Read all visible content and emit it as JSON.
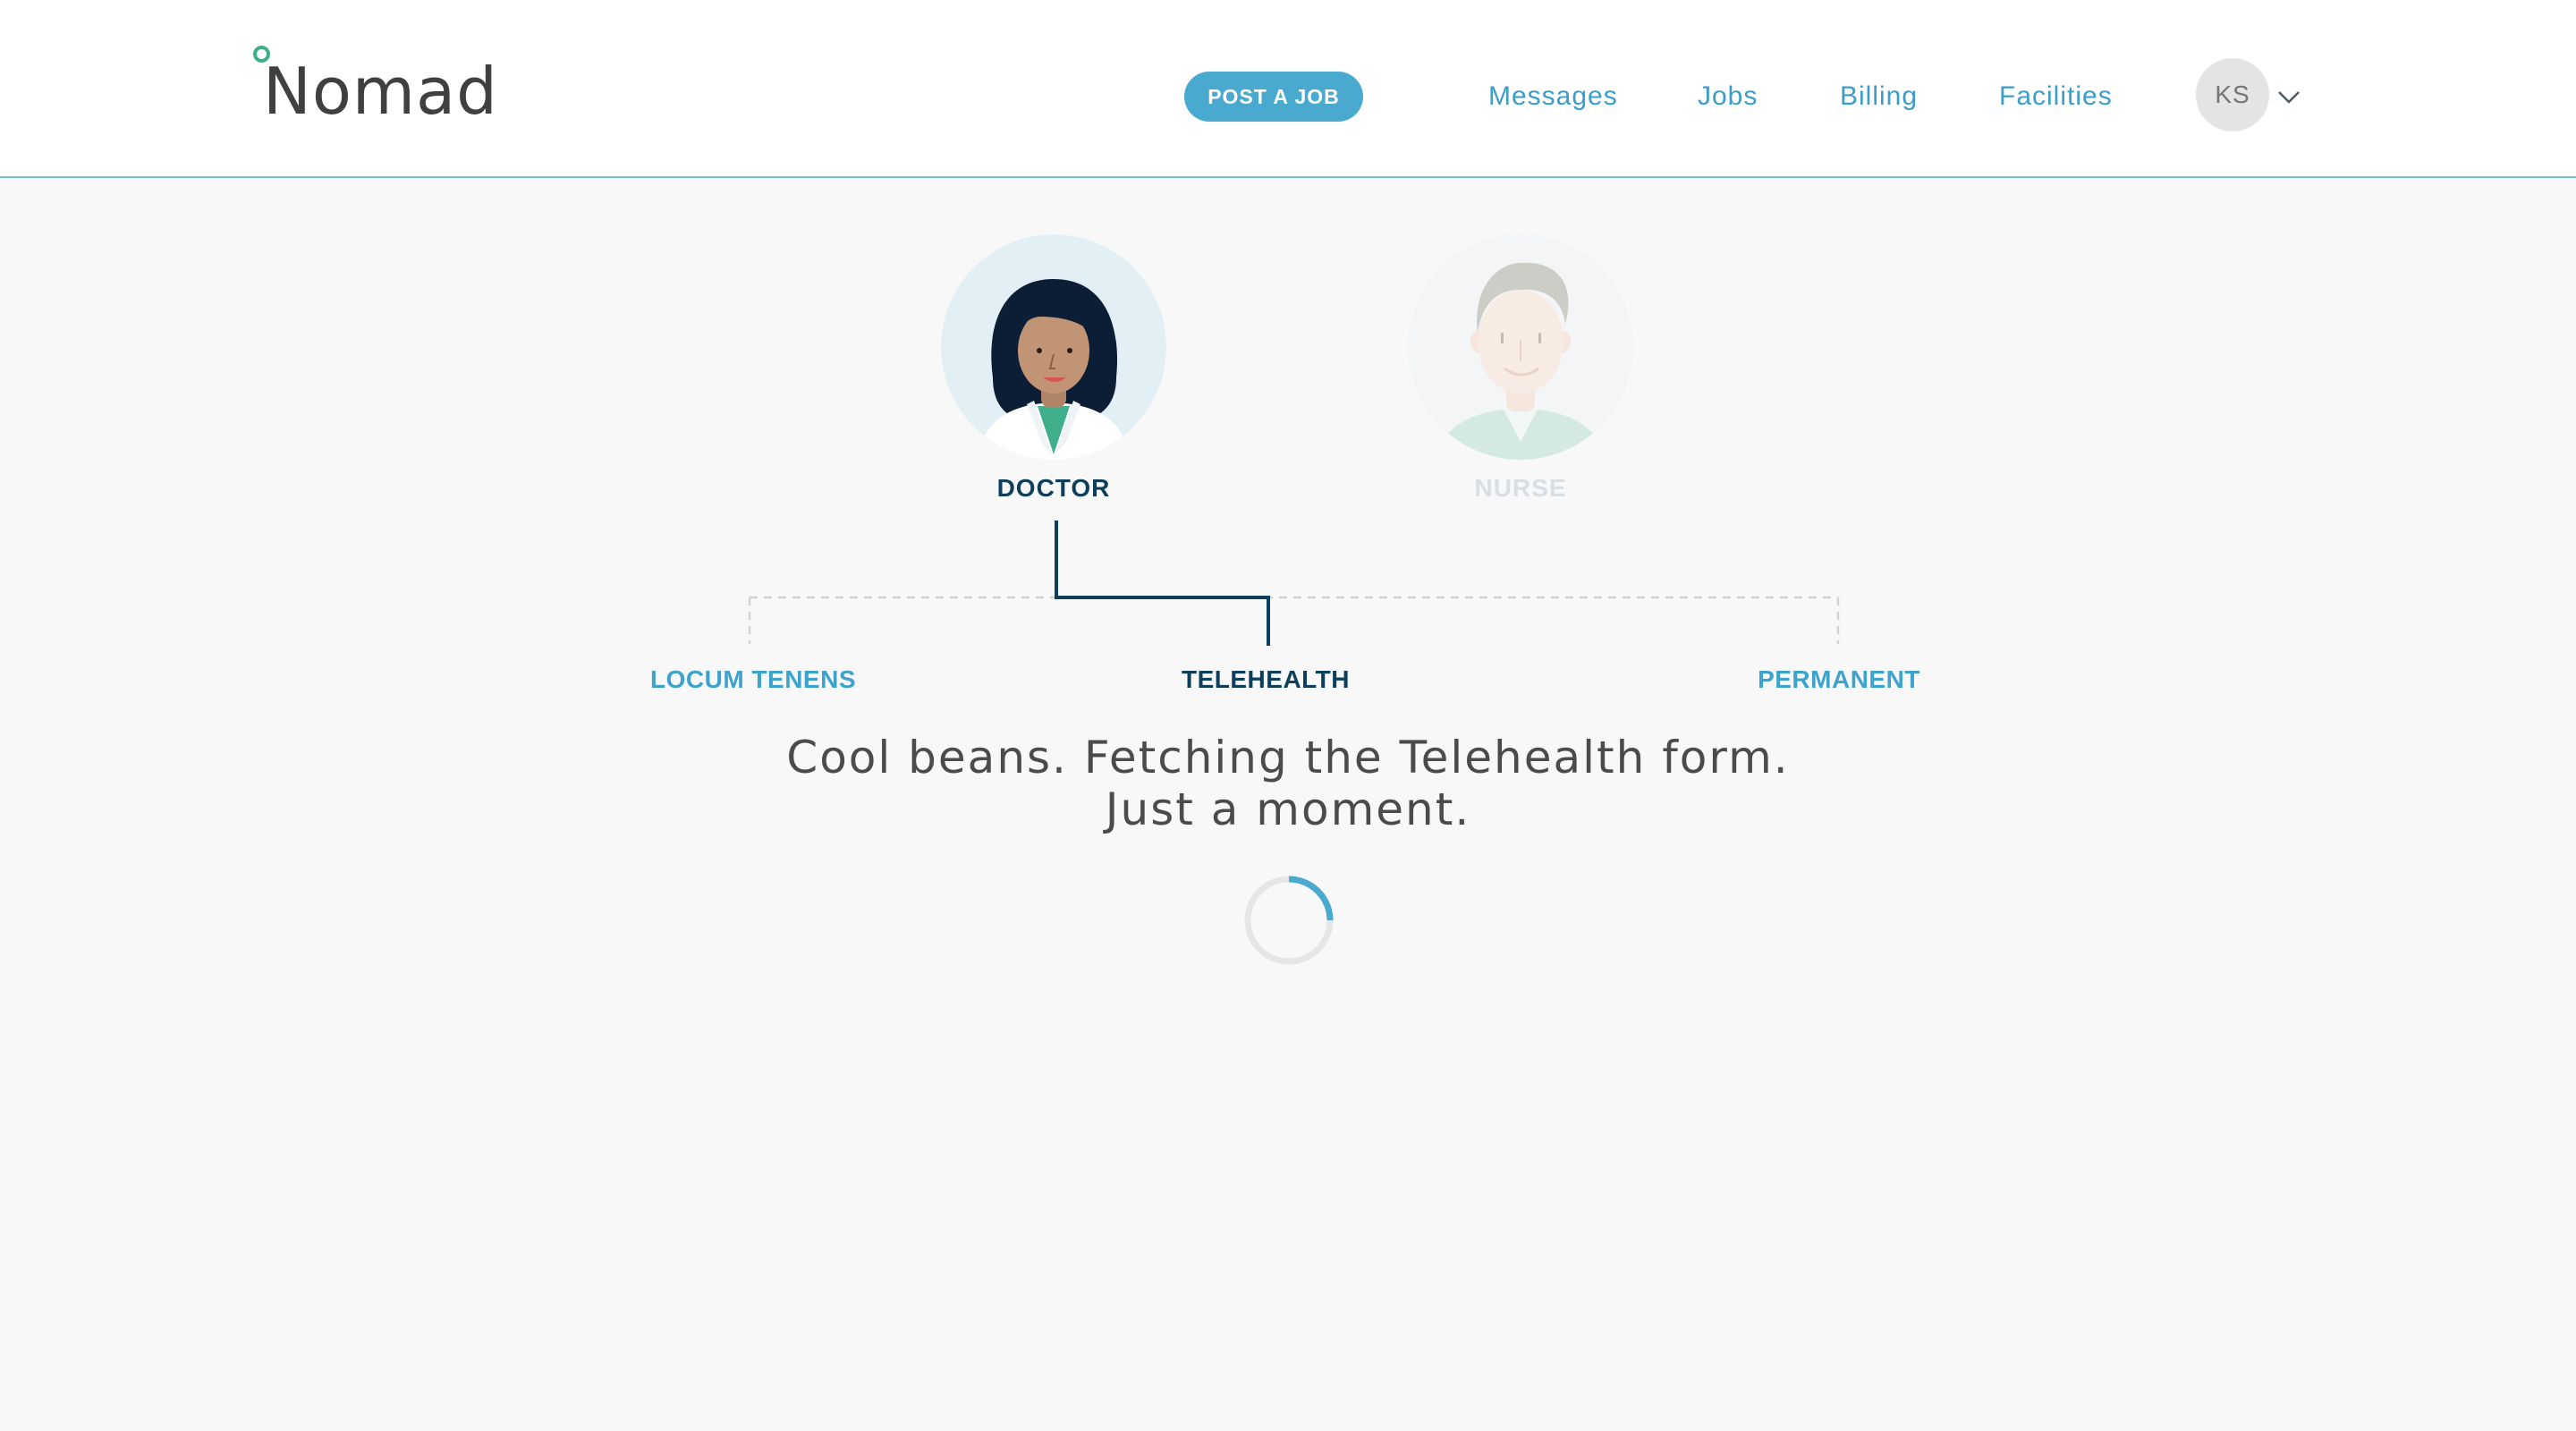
{
  "header": {
    "logo_text": "Nomad",
    "post_job_label": "POST A JOB",
    "nav": [
      {
        "label": "Messages"
      },
      {
        "label": "Jobs"
      },
      {
        "label": "Billing"
      },
      {
        "label": "Facilities"
      }
    ],
    "avatar_initials": "KS",
    "avatar_menu_icon": "chevron-down-icon"
  },
  "roles": [
    {
      "label": "DOCTOR",
      "selected": true,
      "color": "#0d3f5c"
    },
    {
      "label": "NURSE",
      "selected": false,
      "color": "#c9d6dc"
    }
  ],
  "job_types": [
    {
      "label": "LOCUM TENENS",
      "selected": false,
      "color": "#3ea3cc"
    },
    {
      "label": "TELEHEALTH",
      "selected": true,
      "color": "#0d3f5c"
    },
    {
      "label": "PERMANENT",
      "selected": false,
      "color": "#3ea3cc"
    }
  ],
  "message": {
    "line1": "Cool beans. Fetching the Telehealth form.",
    "line2": "Just a moment."
  },
  "colors": {
    "accent": "#4aa9cf",
    "selected_path": "#0d3f5c",
    "header_border": "#6fc7c0",
    "logo_dot": "#3fae8a"
  }
}
